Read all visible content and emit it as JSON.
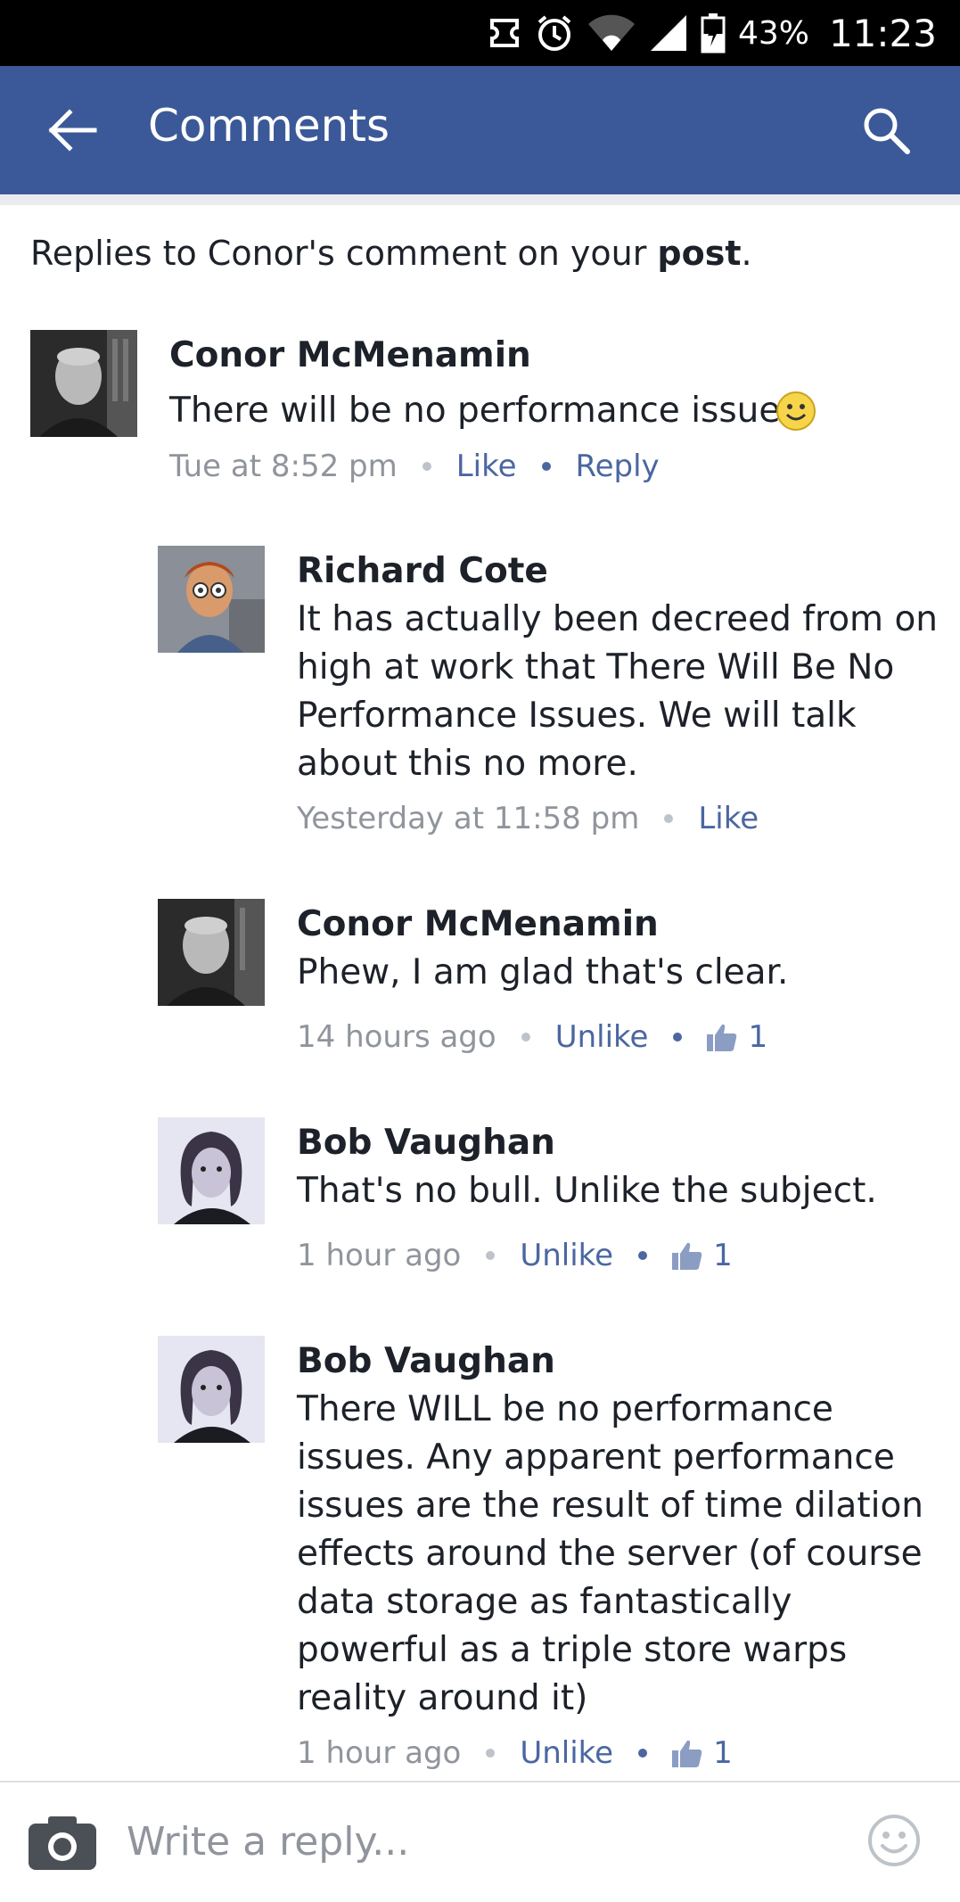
{
  "status_bar": {
    "battery_percent": "43%",
    "time": "11:23"
  },
  "app_bar": {
    "title": "Comments"
  },
  "header": {
    "prefix": "Replies to Conor's comment on your ",
    "link": "post",
    "suffix": "."
  },
  "comments": [
    {
      "author": "Conor McMenamin",
      "text": "There will be no performance issues",
      "has_emoji": true,
      "time": "Tue at 8:52 pm",
      "actions": [
        "Like",
        "Reply"
      ]
    },
    {
      "author": "Richard Cote",
      "text": "It has actually been decreed from on\nhigh at work that There Will Be No\nPerformance Issues. We will talk\nabout this no more.",
      "time": "Yesterday at 11:58 pm",
      "actions": [
        "Like"
      ]
    },
    {
      "author": "Conor McMenamin",
      "text": "Phew, I am glad that's clear.",
      "time": "14 hours ago",
      "actions": [
        "Unlike"
      ],
      "like_count": "1"
    },
    {
      "author": "Bob Vaughan",
      "text": "That's no bull.  Unlike the subject.",
      "time": "1 hour ago",
      "actions": [
        "Unlike"
      ],
      "like_count": "1"
    },
    {
      "author": "Bob Vaughan",
      "text": "There WILL be no performance\nissues.  Any apparent performance\nissues are the result of time dilation\neffects around the server (of course\ndata storage as fantastically\npowerful as a triple store warps\nreality around it)",
      "time": "1 hour ago",
      "actions": [
        "Unlike"
      ],
      "like_count": "1"
    }
  ],
  "reply_bar": {
    "placeholder": "Write a reply..."
  },
  "colors": {
    "brand": "#3b5998",
    "link": "#4b67a1",
    "meta": "#90949c",
    "text": "#1d2129"
  },
  "icons": [
    "back-arrow-icon",
    "search-icon",
    "camera-icon",
    "emoji-icon",
    "thumbs-up-icon",
    "smiley-icon"
  ]
}
